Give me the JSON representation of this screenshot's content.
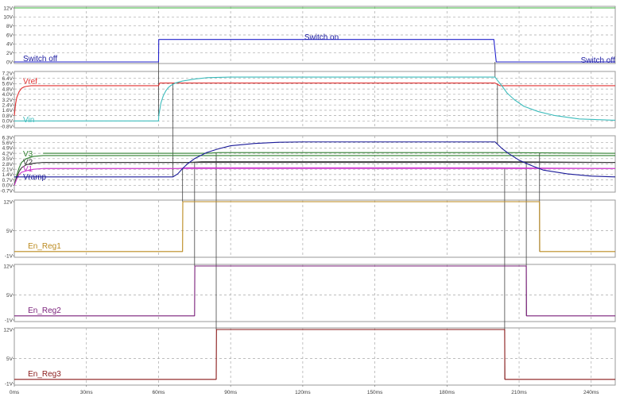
{
  "chart_data": {
    "type": "line",
    "x_unit": "ms",
    "x_range": [
      0,
      250
    ],
    "x_ticks": [
      "0ms",
      "30ms",
      "60ms",
      "90ms",
      "120ms",
      "150ms",
      "180ms",
      "210ms",
      "240ms"
    ],
    "x_tick_values": [
      0,
      30,
      60,
      90,
      120,
      150,
      180,
      210,
      240
    ],
    "panels": [
      {
        "id": "vcc",
        "ylim": [
          0,
          12
        ],
        "y_ticks": [
          "12V",
          "10V",
          "8V",
          "6V",
          "4V",
          "2V",
          "0V"
        ],
        "y_tick_values": [
          12,
          10,
          8,
          6,
          4,
          2,
          0
        ],
        "series": [
          {
            "name": "VCC",
            "color": "#3cb63c",
            "x": [
              0,
              250
            ],
            "y": [
              12,
              12
            ]
          },
          {
            "name": "",
            "color": "#2222cc",
            "x": [
              0,
              60,
              60.1,
              199.5,
              200.5,
              250
            ],
            "y": [
              0,
              0,
              5,
              5,
              0,
              0
            ]
          }
        ],
        "annotations": [
          {
            "text": "Switch off",
            "x": 1,
            "y": 0.8,
            "color": "#1a1aa0"
          },
          {
            "text": "Switch on",
            "x": 118,
            "y": 5.6,
            "color": "#1a1aa0"
          },
          {
            "text": "Switch off",
            "x": 233,
            "y": 0.4,
            "color": "#1a1aa0"
          }
        ]
      },
      {
        "id": "vref",
        "ylim": [
          -0.8,
          7.2
        ],
        "y_ticks": [
          "7.2V",
          "6.4V",
          "5.6V",
          "4.8V",
          "4.0V",
          "3.2V",
          "2.4V",
          "1.6V",
          "0.8V",
          "0.0V",
          "-0.8V"
        ],
        "y_tick_values": [
          7.2,
          6.4,
          5.6,
          4.8,
          4.0,
          3.2,
          2.4,
          1.6,
          0.8,
          0.0,
          -0.8
        ],
        "series": [
          {
            "name": "Vref",
            "color": "#e03030",
            "x": [
              0,
              0.5,
              1,
              2,
              3,
              4,
              5,
              7,
              60,
              60.5,
              200,
              201,
              202,
              250
            ],
            "y": [
              0.8,
              2.5,
              3.5,
              4.4,
              4.9,
              5.1,
              5.2,
              5.3,
              5.3,
              5.7,
              5.7,
              5.5,
              5.3,
              5.3
            ]
          },
          {
            "name": "Vin",
            "color": "#3cbcbc",
            "x": [
              0,
              60,
              60.1,
              61,
              62,
              63,
              64,
              65,
              67,
              70,
              75,
              80,
              90,
              200,
              201,
              203,
              205,
              208,
              212,
              218,
              225,
              235,
              250
            ],
            "y": [
              0,
              0,
              0.8,
              2.7,
              3.8,
              4.5,
              5.0,
              5.3,
              5.7,
              6.0,
              6.3,
              6.5,
              6.6,
              6.6,
              6.1,
              5.2,
              4.2,
              3.2,
              2.2,
              1.4,
              0.8,
              0.3,
              0.1
            ]
          }
        ],
        "annotations": [
          {
            "text": "Vref",
            "x": 1,
            "y": 6.0,
            "color": "#e03030"
          },
          {
            "text": "Vin",
            "x": 1,
            "y": 0.2,
            "color": "#3cbcbc"
          }
        ]
      },
      {
        "id": "vregs",
        "ylim": [
          0.7,
          6.3
        ],
        "y_ticks": [
          "6.3V",
          "5.6V",
          "4.9V",
          "4.2V",
          "3.5V",
          "2.8V",
          "2.1V",
          "1.4V",
          "0.7V",
          "0.0V",
          "-0.7V"
        ],
        "y_tick_values": [
          6.3,
          5.6,
          4.9,
          4.2,
          3.5,
          2.8,
          2.1,
          1.4,
          0.7,
          0.0,
          -0.7
        ],
        "series": [
          {
            "name": "V3",
            "color": "#2f7f2f",
            "x": [
              0,
              1,
              2,
              3,
              5,
              8,
              12,
              80,
              250
            ],
            "y": [
              0,
              1.3,
              2.3,
              3.0,
              3.5,
              3.8,
              3.9,
              3.9,
              3.9
            ]
          },
          {
            "name": "V2",
            "color": "#3a3a3a",
            "x": [
              0,
              1,
              2,
              3,
              5,
              8,
              12,
              250
            ],
            "y": [
              0,
              1.0,
              1.8,
              2.3,
              2.7,
              2.9,
              3.0,
              3.0
            ]
          },
          {
            "name": "V1",
            "color": "#cc33cc",
            "x": [
              0,
              1,
              2,
              3,
              5,
              8,
              12,
              250
            ],
            "y": [
              0,
              0.8,
              1.4,
              1.7,
              1.9,
              2.1,
              2.2,
              2.2
            ]
          },
          {
            "name": "",
            "color": "#2f7f2f",
            "x": [
              12,
              80,
              85,
              200,
              250
            ],
            "y": [
              4.2,
              4.2,
              4.3,
              4.3,
              4.2
            ]
          },
          {
            "name": "",
            "color": "#3a3a3a",
            "x": [
              12,
              73,
              78,
              200,
              250
            ],
            "y": [
              3.0,
              3.0,
              3.1,
              3.1,
              3.0
            ]
          },
          {
            "name": "",
            "color": "#cc33cc",
            "x": [
              12,
              68,
              72,
              200,
              250
            ],
            "y": [
              2.2,
              2.2,
              2.3,
              2.3,
              2.2
            ]
          },
          {
            "name": "Vramp",
            "color": "#1a1a99",
            "x": [
              0,
              66,
              68,
              70,
              72,
              75,
              80,
              85,
              90,
              100,
              110,
              120,
              200,
              201,
              203,
              206,
              210,
              215,
              220,
              230,
              240,
              250
            ],
            "y": [
              1.1,
              1.1,
              1.5,
              2.2,
              2.8,
              3.5,
              4.3,
              4.8,
              5.2,
              5.5,
              5.65,
              5.7,
              5.7,
              5.4,
              4.8,
              4.1,
              3.3,
              2.6,
              2.0,
              1.5,
              1.2,
              1.1
            ]
          }
        ],
        "annotations": [
          {
            "text": "V3",
            "x": 1,
            "y": 4.15,
            "color": "#2f7f2f"
          },
          {
            "text": "V2",
            "x": 1,
            "y": 3.05,
            "color": "#3a3a3a"
          },
          {
            "text": "V1",
            "x": 1,
            "y": 2.15,
            "color": "#cc33cc"
          },
          {
            "text": "Vramp",
            "x": 1,
            "y": 1.15,
            "color": "#1a1a99"
          }
        ]
      },
      {
        "id": "en1",
        "ylim": [
          -1,
          12
        ],
        "y_ticks": [
          "12V",
          "5V",
          "-1V"
        ],
        "y_tick_values": [
          12,
          5,
          -1
        ],
        "series": [
          {
            "name": "En_Reg1",
            "color": "#bb8a1e",
            "x": [
              0,
              70,
              70.1,
              218.5,
              218.6,
              250
            ],
            "y": [
              0,
              0,
              12,
              12,
              0,
              0
            ]
          }
        ],
        "annotations": [
          {
            "text": "En_Reg1",
            "x": 3,
            "y": 1.4,
            "color": "#bb8a1e"
          }
        ]
      },
      {
        "id": "en2",
        "ylim": [
          -1,
          12
        ],
        "y_ticks": [
          "12V",
          "5V",
          "-1V"
        ],
        "y_tick_values": [
          12,
          5,
          -1
        ],
        "series": [
          {
            "name": "En_Reg2",
            "color": "#7a1f7a",
            "x": [
              0,
              75,
              75.1,
              213,
              213.1,
              250
            ],
            "y": [
              0,
              0,
              12,
              12,
              0,
              0
            ]
          }
        ],
        "annotations": [
          {
            "text": "En_Reg2",
            "x": 3,
            "y": 1.4,
            "color": "#7a1f7a"
          }
        ]
      },
      {
        "id": "en3",
        "ylim": [
          -1,
          12
        ],
        "y_ticks": [
          "12V",
          "5V",
          "-1V"
        ],
        "y_tick_values": [
          12,
          5,
          -1
        ],
        "series": [
          {
            "name": "En_Reg3",
            "color": "#8a1a1a",
            "x": [
              0,
              84,
              84.1,
              204,
              204.1,
              250
            ],
            "y": [
              0,
              0,
              12,
              12,
              0,
              0
            ]
          }
        ],
        "annotations": [
          {
            "text": "En_Reg3",
            "x": 3,
            "y": 1.4,
            "color": "#8a1a1a"
          }
        ]
      }
    ],
    "connectors": [
      {
        "x": 60,
        "from_panel": "vcc",
        "from_y": 0,
        "to_panel": "vref",
        "to_y": 0.8
      },
      {
        "x": 66,
        "from_panel": "vref",
        "from_y": 5.7,
        "to_panel": "vregs",
        "to_y": 1.1
      },
      {
        "x": 70,
        "from_panel": "vregs",
        "from_y": 2.2,
        "to_panel": "en1",
        "to_y": 12
      },
      {
        "x": 75,
        "from_panel": "vregs",
        "from_y": 3.0,
        "to_panel": "en2",
        "to_y": 12
      },
      {
        "x": 84,
        "from_panel": "vregs",
        "from_y": 4.2,
        "to_panel": "en3",
        "to_y": 12
      },
      {
        "x": 200,
        "from_panel": "vcc",
        "from_y": 0,
        "to_panel": "vref",
        "to_y": 6.6
      },
      {
        "x": 201,
        "from_panel": "vref",
        "from_y": 5.5,
        "to_panel": "vregs",
        "to_y": 5.4
      },
      {
        "x": 204,
        "from_panel": "vregs",
        "from_y": 2.2,
        "to_panel": "en3",
        "to_y": 0
      },
      {
        "x": 213,
        "from_panel": "vregs",
        "from_y": 3.0,
        "to_panel": "en2",
        "to_y": 0
      },
      {
        "x": 218.5,
        "from_panel": "vregs",
        "from_y": 4.2,
        "to_panel": "en1",
        "to_y": 0
      }
    ]
  }
}
